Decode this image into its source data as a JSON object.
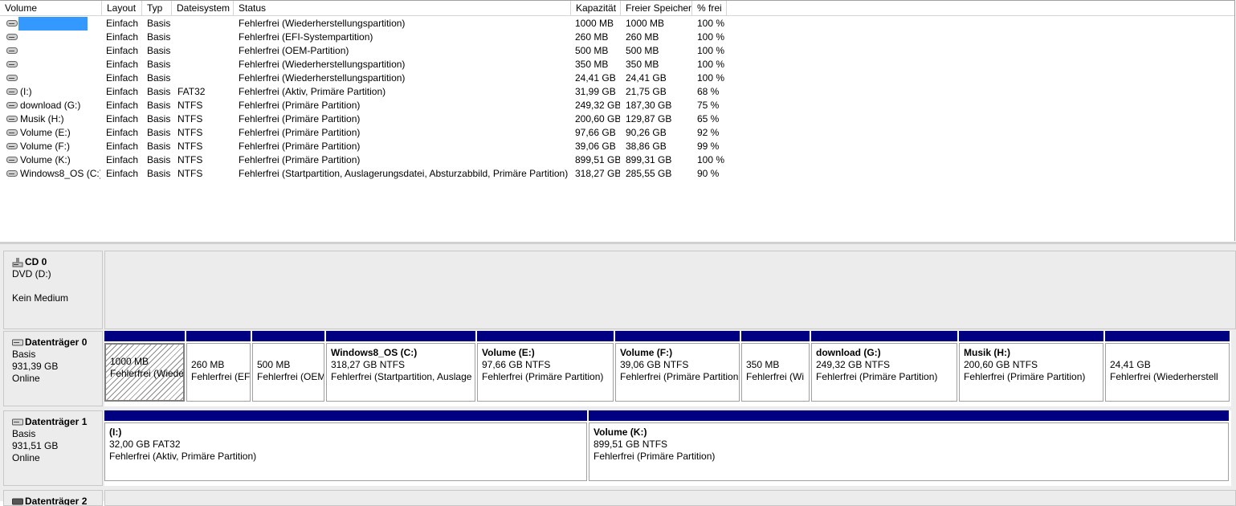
{
  "columns": [
    "Volume",
    "Layout",
    "Typ",
    "Dateisystem",
    "Status",
    "Kapazität",
    "Freier Speicher",
    "% frei"
  ],
  "volumes": [
    {
      "name": "",
      "layout": "Einfach",
      "typ": "Basis",
      "fs": "",
      "status": "Fehlerfrei (Wiederherstellungspartition)",
      "cap": "1000 MB",
      "free": "1000 MB",
      "pct": "100 %"
    },
    {
      "name": "",
      "layout": "Einfach",
      "typ": "Basis",
      "fs": "",
      "status": "Fehlerfrei (EFI-Systempartition)",
      "cap": "260 MB",
      "free": "260 MB",
      "pct": "100 %"
    },
    {
      "name": "",
      "layout": "Einfach",
      "typ": "Basis",
      "fs": "",
      "status": "Fehlerfrei (OEM-Partition)",
      "cap": "500 MB",
      "free": "500 MB",
      "pct": "100 %"
    },
    {
      "name": "",
      "layout": "Einfach",
      "typ": "Basis",
      "fs": "",
      "status": "Fehlerfrei (Wiederherstellungspartition)",
      "cap": "350 MB",
      "free": "350 MB",
      "pct": "100 %"
    },
    {
      "name": "",
      "layout": "Einfach",
      "typ": "Basis",
      "fs": "",
      "status": "Fehlerfrei (Wiederherstellungspartition)",
      "cap": "24,41 GB",
      "free": "24,41 GB",
      "pct": "100 %"
    },
    {
      "name": "(I:)",
      "layout": "Einfach",
      "typ": "Basis",
      "fs": "FAT32",
      "status": "Fehlerfrei (Aktiv, Primäre Partition)",
      "cap": "31,99 GB",
      "free": "21,75 GB",
      "pct": "68 %"
    },
    {
      "name": "download (G:)",
      "layout": "Einfach",
      "typ": "Basis",
      "fs": "NTFS",
      "status": "Fehlerfrei (Primäre Partition)",
      "cap": "249,32 GB",
      "free": "187,30 GB",
      "pct": "75 %"
    },
    {
      "name": "Musik (H:)",
      "layout": "Einfach",
      "typ": "Basis",
      "fs": "NTFS",
      "status": "Fehlerfrei (Primäre Partition)",
      "cap": "200,60 GB",
      "free": "129,87 GB",
      "pct": "65 %"
    },
    {
      "name": "Volume (E:)",
      "layout": "Einfach",
      "typ": "Basis",
      "fs": "NTFS",
      "status": "Fehlerfrei (Primäre Partition)",
      "cap": "97,66 GB",
      "free": "90,26 GB",
      "pct": "92 %"
    },
    {
      "name": "Volume (F:)",
      "layout": "Einfach",
      "typ": "Basis",
      "fs": "NTFS",
      "status": "Fehlerfrei (Primäre Partition)",
      "cap": "39,06 GB",
      "free": "38,86 GB",
      "pct": "99 %"
    },
    {
      "name": "Volume (K:)",
      "layout": "Einfach",
      "typ": "Basis",
      "fs": "NTFS",
      "status": "Fehlerfrei (Primäre Partition)",
      "cap": "899,51 GB",
      "free": "899,31 GB",
      "pct": "100 %"
    },
    {
      "name": "Windows8_OS (C:)",
      "layout": "Einfach",
      "typ": "Basis",
      "fs": "NTFS",
      "status": "Fehlerfrei (Startpartition, Auslagerungsdatei, Absturzabbild, Primäre Partition)",
      "cap": "318,27 GB",
      "free": "285,55 GB",
      "pct": "90 %"
    }
  ],
  "cd0": {
    "title": "CD 0",
    "line1": "DVD (D:)",
    "line2": "Kein Medium"
  },
  "disk0": {
    "title": "Datenträger 0",
    "type": "Basis",
    "size": "931,39 GB",
    "status": "Online",
    "parts": [
      {
        "name": "",
        "l1": "1000 MB",
        "l2": "Fehlerfrei (Wiede"
      },
      {
        "name": "",
        "l1": "260 MB",
        "l2": "Fehlerfrei (EF"
      },
      {
        "name": "",
        "l1": "500 MB",
        "l2": "Fehlerfrei (OEM"
      },
      {
        "name": "Windows8_OS  (C:)",
        "l1": "318,27 GB NTFS",
        "l2": "Fehlerfrei (Startpartition, Auslage"
      },
      {
        "name": "Volume  (E:)",
        "l1": "97,66 GB NTFS",
        "l2": "Fehlerfrei (Primäre Partition)"
      },
      {
        "name": "Volume  (F:)",
        "l1": "39,06 GB NTFS",
        "l2": "Fehlerfrei (Primäre Partition"
      },
      {
        "name": "",
        "l1": "350 MB",
        "l2": "Fehlerfrei (Wi"
      },
      {
        "name": "download  (G:)",
        "l1": "249,32 GB NTFS",
        "l2": "Fehlerfrei (Primäre Partition)"
      },
      {
        "name": "Musik  (H:)",
        "l1": "200,60 GB NTFS",
        "l2": "Fehlerfrei (Primäre Partition)"
      },
      {
        "name": "",
        "l1": "24,41 GB",
        "l2": "Fehlerfrei (Wiederherstell"
      }
    ]
  },
  "disk1": {
    "title": "Datenträger 1",
    "type": "Basis",
    "size": "931,51 GB",
    "status": "Online",
    "parts": [
      {
        "name": "(I:)",
        "l1": "32,00 GB FAT32",
        "l2": "Fehlerfrei (Aktiv, Primäre Partition)"
      },
      {
        "name": "Volume  (K:)",
        "l1": "899,51 GB NTFS",
        "l2": "Fehlerfrei (Primäre Partition)"
      }
    ]
  },
  "disk2": {
    "title": "Datenträger 2"
  },
  "colors": {
    "partition_bar": "#000080",
    "selection": "#3399ff",
    "panel": "#ececec"
  }
}
